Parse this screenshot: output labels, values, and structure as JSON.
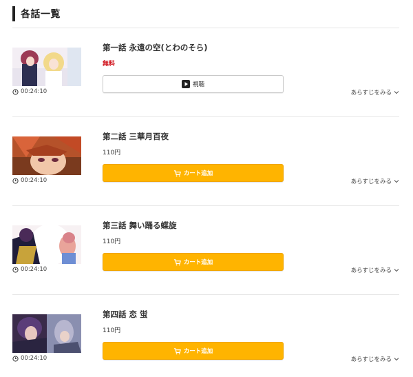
{
  "header": {
    "title": "各話一覧"
  },
  "episodes": [
    {
      "title": "第一話 永遠の空(とわのそら)",
      "price": "無料",
      "button_label": "視聴",
      "button_type": "watch",
      "duration": "00:24:10",
      "synopsis_label": "あらすじをみる"
    },
    {
      "title": "第二話 三華月百夜",
      "price": "110円",
      "button_label": "カート追加",
      "button_type": "cart",
      "duration": "00:24:10",
      "synopsis_label": "あらすじをみる"
    },
    {
      "title": "第三話 舞い踊る蝶旋",
      "price": "110円",
      "button_label": "カート追加",
      "button_type": "cart",
      "duration": "00:24:10",
      "synopsis_label": "あらすじをみる"
    },
    {
      "title": "第四話 恋 蛍",
      "price": "110円",
      "button_label": "カート追加",
      "button_type": "cart",
      "duration": "00:24:10",
      "synopsis_label": "あらすじをみる"
    }
  ],
  "colors": {
    "cart_button": "#ffb400",
    "free_price": "#d0121b",
    "header_bar": "#222222"
  },
  "icons": {
    "watch": "play-icon",
    "cart": "cart-icon",
    "duration": "clock-icon",
    "synopsis": "chevron-down-icon"
  }
}
